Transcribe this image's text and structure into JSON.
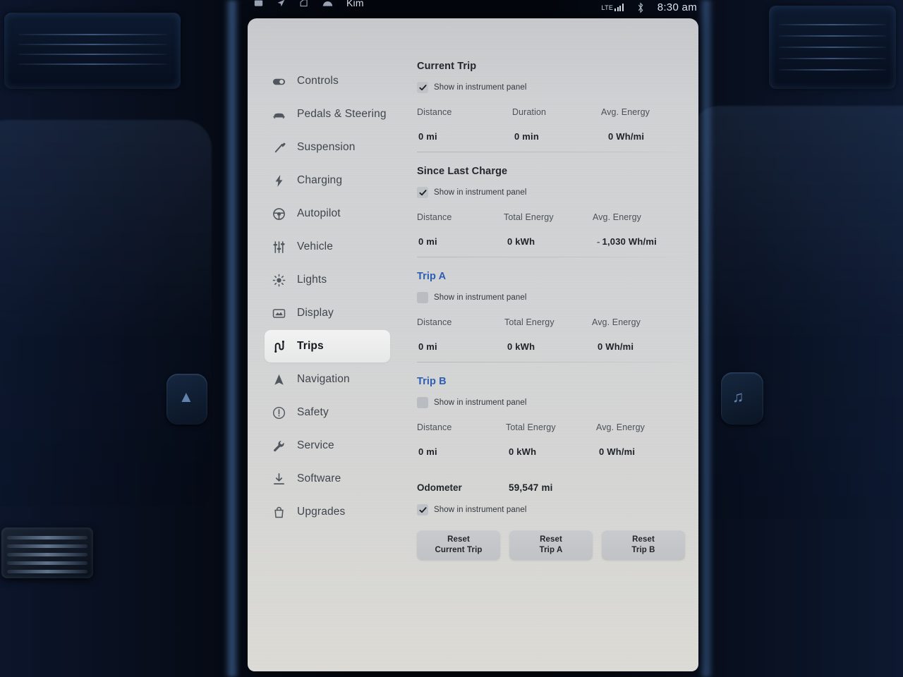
{
  "status_bar": {
    "profile_name": "Kim",
    "left_icons": [
      "media-icon",
      "nav-arrow-icon",
      "car-door-icon",
      "climate-icon"
    ],
    "network_label": "LTE",
    "signal_bars": 4,
    "bluetooth_icon": "bluetooth-icon",
    "time": "8:30 am"
  },
  "sidebar": {
    "items": [
      {
        "label": "Controls",
        "icon": "toggle-icon",
        "active": false
      },
      {
        "label": "Pedals & Steering",
        "icon": "car-front-icon",
        "active": false
      },
      {
        "label": "Suspension",
        "icon": "shock-absorber-icon",
        "active": false
      },
      {
        "label": "Charging",
        "icon": "lightning-bolt-icon",
        "active": false
      },
      {
        "label": "Autopilot",
        "icon": "steering-wheel-icon",
        "active": false
      },
      {
        "label": "Vehicle",
        "icon": "sliders-icon",
        "active": false
      },
      {
        "label": "Lights",
        "icon": "sun-icon",
        "active": false
      },
      {
        "label": "Display",
        "icon": "screen-icon",
        "active": false
      },
      {
        "label": "Trips",
        "icon": "winding-road-icon",
        "active": true
      },
      {
        "label": "Navigation",
        "icon": "navigation-arrow-icon",
        "active": false
      },
      {
        "label": "Safety",
        "icon": "exclamation-circle-icon",
        "active": false
      },
      {
        "label": "Service",
        "icon": "wrench-icon",
        "active": false
      },
      {
        "label": "Software",
        "icon": "download-icon",
        "active": false
      },
      {
        "label": "Upgrades",
        "icon": "bag-icon",
        "active": false
      }
    ]
  },
  "main": {
    "checkbox_label": "Show in instrument panel",
    "sections": [
      {
        "title": "Current Trip",
        "title_is_link": false,
        "show_in_instrument_panel": true,
        "stats": [
          {
            "label": "Distance",
            "value": "0",
            "unit": "mi"
          },
          {
            "label": "Duration",
            "value": "0",
            "unit": "min"
          },
          {
            "label": "Avg. Energy",
            "value": "0",
            "unit": "Wh/mi"
          }
        ]
      },
      {
        "title": "Since Last Charge",
        "title_is_link": false,
        "show_in_instrument_panel": true,
        "stats": [
          {
            "label": "Distance",
            "value": "0",
            "unit": "mi"
          },
          {
            "label": "Total Energy",
            "value": "0",
            "unit": "kWh"
          },
          {
            "label": "Avg. Energy",
            "value": "1,030",
            "unit": "Wh/mi",
            "negative": true
          }
        ]
      },
      {
        "title": "Trip A",
        "title_is_link": true,
        "show_in_instrument_panel": false,
        "stats": [
          {
            "label": "Distance",
            "value": "0",
            "unit": "mi"
          },
          {
            "label": "Total Energy",
            "value": "0",
            "unit": "kWh"
          },
          {
            "label": "Avg. Energy",
            "value": "0",
            "unit": "Wh/mi"
          }
        ]
      },
      {
        "title": "Trip B",
        "title_is_link": true,
        "show_in_instrument_panel": false,
        "stats": [
          {
            "label": "Distance",
            "value": "0",
            "unit": "mi"
          },
          {
            "label": "Total Energy",
            "value": "0",
            "unit": "kWh"
          },
          {
            "label": "Avg. Energy",
            "value": "0",
            "unit": "Wh/mi"
          }
        ]
      }
    ],
    "odometer": {
      "label": "Odometer",
      "value": "59,547",
      "unit": "mi",
      "show_in_instrument_panel": true
    },
    "buttons": [
      {
        "line1": "Reset",
        "line2": "Current Trip",
        "name": "reset-current-trip-button"
      },
      {
        "line1": "Reset",
        "line2": "Trip A",
        "name": "reset-trip-a-button"
      },
      {
        "line1": "Reset",
        "line2": "Trip B",
        "name": "reset-trip-b-button"
      }
    ]
  },
  "colors": {
    "link": "#2c5fb4",
    "screen_bg": "#d2d3d4",
    "text_primary": "#1d2127",
    "text_secondary": "#4b5158"
  }
}
